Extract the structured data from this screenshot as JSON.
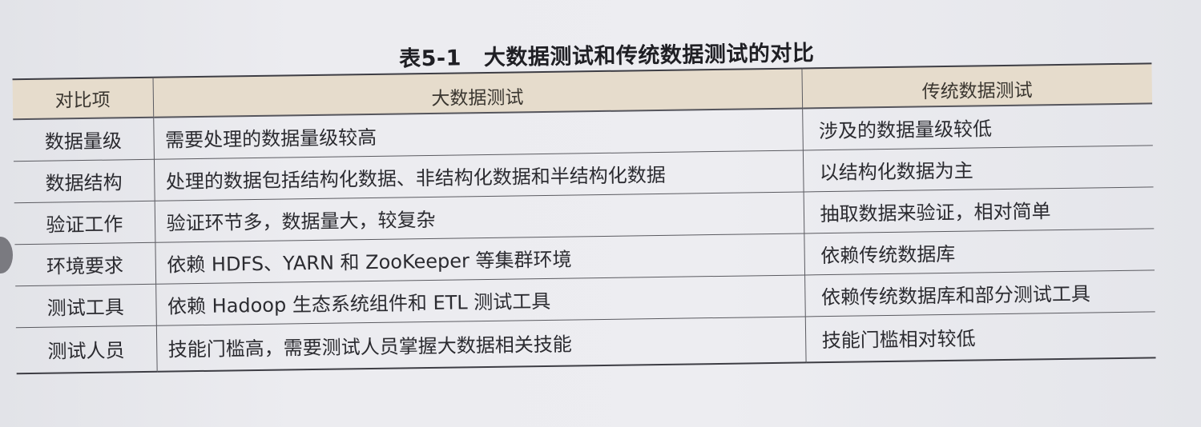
{
  "caption": {
    "number": "表5-1",
    "title": "大数据测试和传统数据测试的对比"
  },
  "table": {
    "headers": [
      "对比项",
      "大数据测试",
      "传统数据测试"
    ],
    "rows": [
      {
        "item": "数据量级",
        "big_data": "需要处理的数据量级较高",
        "traditional": "涉及的数据量级较低"
      },
      {
        "item": "数据结构",
        "big_data": "处理的数据包括结构化数据、非结构化数据和半结构化数据",
        "traditional": "以结构化数据为主"
      },
      {
        "item": "验证工作",
        "big_data": "验证环节多，数据量大，较复杂",
        "traditional": "抽取数据来验证，相对简单"
      },
      {
        "item": "环境要求",
        "big_data": "依赖 HDFS、YARN 和 ZooKeeper 等集群环境",
        "traditional": "依赖传统数据库"
      },
      {
        "item": "测试工具",
        "big_data": "依赖 Hadoop 生态系统组件和 ETL 测试工具",
        "traditional": "依赖传统数据库和部分测试工具"
      },
      {
        "item": "测试人员",
        "big_data": "技能门槛高，需要测试人员掌握大数据相关技能",
        "traditional": "技能门槛相对较低"
      }
    ]
  },
  "colors": {
    "header_bg": "#e6dccc",
    "page_bg": "#ececf0",
    "rule": "#3d3d44"
  }
}
